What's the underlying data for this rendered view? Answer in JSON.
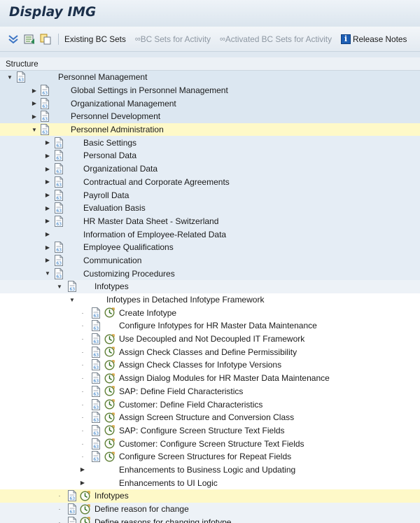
{
  "window": {
    "title": "Display IMG"
  },
  "toolbar": {
    "existing_bc_sets": "Existing BC Sets",
    "bc_sets_for_activity": "BC Sets for Activity",
    "activated_bc_sets": "Activated BC Sets for Activity",
    "release_notes": "Release Notes"
  },
  "structure": {
    "header": "Structure",
    "items": [
      {
        "label": "Personnel Management",
        "level": 0,
        "expanded": true,
        "doc": true,
        "clock": false,
        "selected": false
      },
      {
        "label": "Global Settings in Personnel Management",
        "level": 1,
        "expanded": false,
        "doc": true,
        "clock": false,
        "selected": false
      },
      {
        "label": "Organizational Management",
        "level": 1,
        "expanded": false,
        "doc": true,
        "clock": false,
        "selected": false
      },
      {
        "label": "Personnel Development",
        "level": 1,
        "expanded": false,
        "doc": true,
        "clock": false,
        "selected": false
      },
      {
        "label": "Personnel Administration",
        "level": 1,
        "expanded": true,
        "doc": true,
        "clock": false,
        "selected": true
      },
      {
        "label": "Basic Settings",
        "level": 2,
        "expanded": false,
        "doc": true,
        "clock": false,
        "selected": false
      },
      {
        "label": "Personal Data",
        "level": 2,
        "expanded": false,
        "doc": true,
        "clock": false,
        "selected": false
      },
      {
        "label": "Organizational Data",
        "level": 2,
        "expanded": false,
        "doc": true,
        "clock": false,
        "selected": false
      },
      {
        "label": "Contractual and Corporate Agreements",
        "level": 2,
        "expanded": false,
        "doc": true,
        "clock": false,
        "selected": false
      },
      {
        "label": "Payroll Data",
        "level": 2,
        "expanded": false,
        "doc": true,
        "clock": false,
        "selected": false
      },
      {
        "label": "Evaluation Basis",
        "level": 2,
        "expanded": false,
        "doc": true,
        "clock": false,
        "selected": false
      },
      {
        "label": "HR Master Data Sheet - Switzerland",
        "level": 2,
        "expanded": false,
        "doc": true,
        "clock": false,
        "selected": false
      },
      {
        "label": "Information of Employee-Related Data",
        "level": 2,
        "expanded": false,
        "doc": false,
        "clock": false,
        "selected": false
      },
      {
        "label": "Employee Qualifications",
        "level": 2,
        "expanded": false,
        "doc": true,
        "clock": false,
        "selected": false
      },
      {
        "label": "Communication",
        "level": 2,
        "expanded": false,
        "doc": true,
        "clock": false,
        "selected": false
      },
      {
        "label": "Customizing Procedures",
        "level": 2,
        "expanded": true,
        "doc": true,
        "clock": false,
        "selected": false
      },
      {
        "label": "Infotypes",
        "level": 3,
        "expanded": true,
        "doc": true,
        "clock": false,
        "selected": false
      },
      {
        "label": "Infotypes in Detached Infotype Framework",
        "level": 4,
        "expanded": true,
        "doc": false,
        "clock": false,
        "selected": false
      },
      {
        "label": "Create Infotype",
        "level": 5,
        "leaf": true,
        "doc": true,
        "clock": true,
        "selected": false
      },
      {
        "label": "Configure Infotypes for HR Master Data Maintenance",
        "level": 5,
        "leaf": true,
        "doc": true,
        "clock": false,
        "selected": false
      },
      {
        "label": "Use Decoupled and Not Decoupled IT Framework",
        "level": 5,
        "leaf": true,
        "doc": true,
        "clock": true,
        "selected": false
      },
      {
        "label": "Assign Check Classes and Define Permissibility",
        "level": 5,
        "leaf": true,
        "doc": true,
        "clock": true,
        "selected": false
      },
      {
        "label": "Assign Check Classes for Infotype Versions",
        "level": 5,
        "leaf": true,
        "doc": true,
        "clock": true,
        "selected": false
      },
      {
        "label": "Assign Dialog Modules for HR Master Data Maintenance",
        "level": 5,
        "leaf": true,
        "doc": true,
        "clock": true,
        "selected": false
      },
      {
        "label": "SAP: Define Field Characteristics",
        "level": 5,
        "leaf": true,
        "doc": true,
        "clock": true,
        "selected": false
      },
      {
        "label": "Customer: Define Field Characteristics",
        "level": 5,
        "leaf": true,
        "doc": true,
        "clock": true,
        "selected": false
      },
      {
        "label": "Assign Screen Structure and Conversion Class",
        "level": 5,
        "leaf": true,
        "doc": true,
        "clock": true,
        "selected": false
      },
      {
        "label": "SAP: Configure Screen Structure Text Fields",
        "level": 5,
        "leaf": true,
        "doc": true,
        "clock": true,
        "selected": false
      },
      {
        "label": "Customer: Configure Screen Structure Text Fields",
        "level": 5,
        "leaf": true,
        "doc": true,
        "clock": true,
        "selected": false
      },
      {
        "label": "Configure Screen Structures for Repeat Fields",
        "level": 5,
        "leaf": true,
        "doc": true,
        "clock": true,
        "selected": false
      },
      {
        "label": "Enhancements to Business Logic and Updating",
        "level": 5,
        "expanded": false,
        "doc": false,
        "clock": false,
        "selected": false
      },
      {
        "label": "Enhancements to UI Logic",
        "level": 5,
        "expanded": false,
        "doc": false,
        "clock": false,
        "selected": false
      },
      {
        "label": "Infotypes",
        "level": 3,
        "leaf": true,
        "doc": true,
        "clock": true,
        "selected": true
      },
      {
        "label": "Define reason for change",
        "level": 3,
        "leaf": true,
        "doc": true,
        "clock": true,
        "selected": false
      },
      {
        "label": "Define reasons for changing infotype",
        "level": 3,
        "leaf": true,
        "doc": true,
        "clock": true,
        "selected": false
      }
    ]
  }
}
